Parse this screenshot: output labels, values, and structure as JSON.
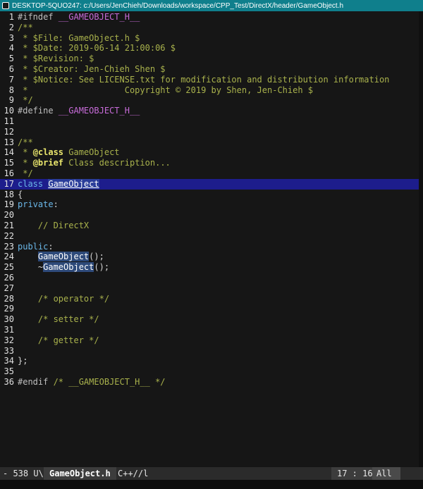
{
  "window": {
    "title": "DESKTOP-5QUO247: c:/Users/JenChieh/Downloads/workspace/CPP_Test/DirectX/header/GameObject.h"
  },
  "editor": {
    "current_line": 17,
    "lines": [
      {
        "n": "1",
        "segs": [
          [
            "pp",
            "#ifndef "
          ],
          [
            "pp-name",
            "__GAMEOBJECT_H__"
          ]
        ]
      },
      {
        "n": "2",
        "segs": [
          [
            "cm",
            "/**"
          ]
        ]
      },
      {
        "n": "3",
        "segs": [
          [
            "cm",
            " * $File: GameObject.h $"
          ]
        ]
      },
      {
        "n": "4",
        "segs": [
          [
            "cm",
            " * $Date: 2019-06-14 21:00:06 $"
          ]
        ]
      },
      {
        "n": "5",
        "segs": [
          [
            "cm",
            " * $Revision: $"
          ]
        ]
      },
      {
        "n": "6",
        "segs": [
          [
            "cm",
            " * $Creator: Jen-Chieh Shen $"
          ]
        ]
      },
      {
        "n": "7",
        "segs": [
          [
            "cm",
            " * $Notice: See LICENSE.txt for modification and distribution information"
          ]
        ]
      },
      {
        "n": "8",
        "segs": [
          [
            "cm",
            " *                   Copyright © 2019 by Shen, Jen-Chieh $"
          ]
        ]
      },
      {
        "n": "9",
        "segs": [
          [
            "cm",
            " */"
          ]
        ]
      },
      {
        "n": "10",
        "segs": [
          [
            "pp",
            "#define "
          ],
          [
            "pp-name",
            "__GAMEOBJECT_H__"
          ]
        ]
      },
      {
        "n": "11",
        "segs": []
      },
      {
        "n": "12",
        "segs": []
      },
      {
        "n": "13",
        "segs": [
          [
            "cm",
            "/**"
          ]
        ]
      },
      {
        "n": "14",
        "segs": [
          [
            "cm",
            " * "
          ],
          [
            "tag",
            "@class"
          ],
          [
            "cm",
            " GameObject"
          ]
        ]
      },
      {
        "n": "15",
        "segs": [
          [
            "cm",
            " * "
          ],
          [
            "tag",
            "@brief"
          ],
          [
            "cm",
            " Class description..."
          ]
        ]
      },
      {
        "n": "16",
        "segs": [
          [
            "cm",
            " */"
          ]
        ]
      },
      {
        "n": "17",
        "segs": [
          [
            "kw",
            "class "
          ],
          [
            "hl-cur",
            "GameObject"
          ]
        ]
      },
      {
        "n": "18",
        "segs": [
          [
            "pun",
            "{"
          ]
        ]
      },
      {
        "n": "19",
        "segs": [
          [
            "kw",
            "private"
          ],
          [
            "pun",
            ":"
          ]
        ]
      },
      {
        "n": "20",
        "segs": []
      },
      {
        "n": "21",
        "segs": [
          [
            "cm",
            "    // DirectX"
          ]
        ]
      },
      {
        "n": "22",
        "segs": []
      },
      {
        "n": "23",
        "segs": [
          [
            "kw",
            "public"
          ],
          [
            "pun",
            ":"
          ]
        ]
      },
      {
        "n": "24",
        "segs": [
          [
            "pun",
            "    "
          ],
          [
            "hl",
            "GameObject"
          ],
          [
            "pun",
            "();"
          ]
        ]
      },
      {
        "n": "25",
        "segs": [
          [
            "pun",
            "    ~"
          ],
          [
            "hl",
            "GameObject"
          ],
          [
            "pun",
            "();"
          ]
        ]
      },
      {
        "n": "26",
        "segs": []
      },
      {
        "n": "27",
        "segs": []
      },
      {
        "n": "28",
        "segs": [
          [
            "cm",
            "    /* operator */"
          ]
        ]
      },
      {
        "n": "29",
        "segs": []
      },
      {
        "n": "30",
        "segs": [
          [
            "cm",
            "    /* setter */"
          ]
        ]
      },
      {
        "n": "31",
        "segs": []
      },
      {
        "n": "32",
        "segs": [
          [
            "cm",
            "    /* getter */"
          ]
        ]
      },
      {
        "n": "33",
        "segs": []
      },
      {
        "n": "34",
        "segs": [
          [
            "pun",
            "};"
          ]
        ]
      },
      {
        "n": "35",
        "segs": []
      },
      {
        "n": "36",
        "segs": [
          [
            "pp",
            "#endif "
          ],
          [
            "cm",
            "/* __GAMEOBJECT_H__ */"
          ]
        ]
      }
    ]
  },
  "statusbar": {
    "mode": "- 538 U\\",
    "filename": "GameObject.h",
    "language": "C++//l",
    "position": "17 : 16",
    "percent": "All"
  },
  "colors": {
    "titlebar": "#0f7f8c",
    "current_line": "#1d1d8c",
    "keyword": "#6ab7e8",
    "comment": "#a9b24c",
    "macro": "#c76bd8"
  }
}
